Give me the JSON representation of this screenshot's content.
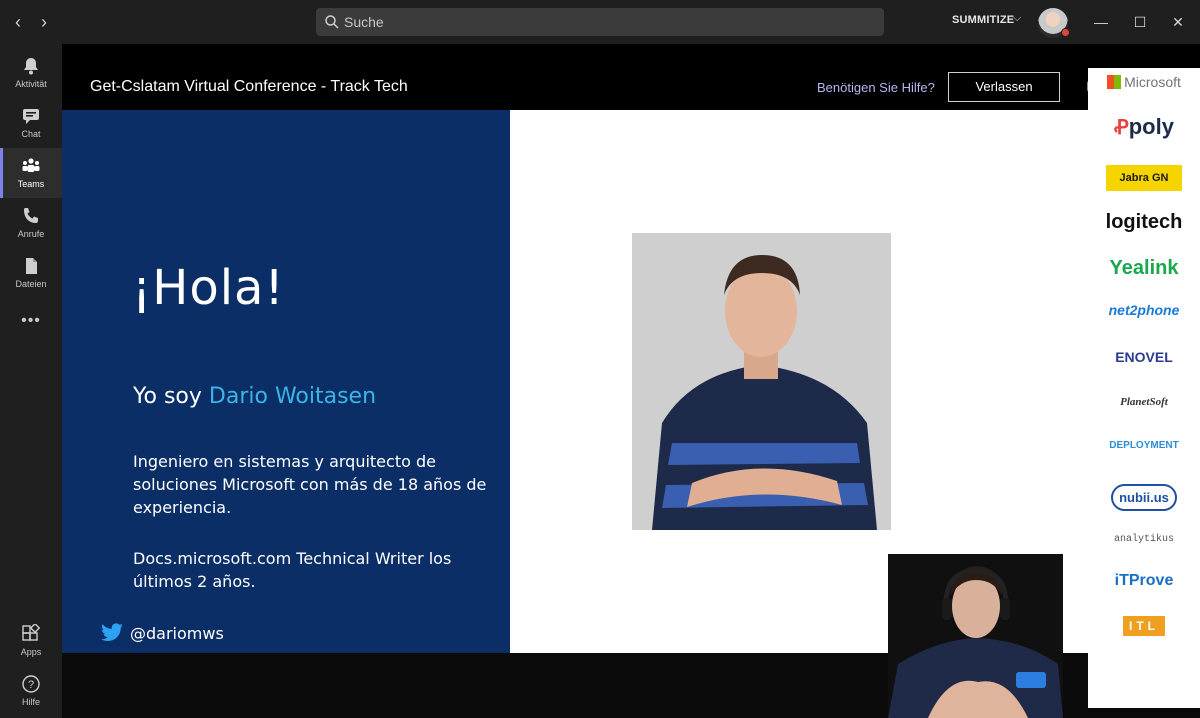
{
  "titlebar": {
    "back": "‹",
    "forward": "›",
    "search_placeholder": "Suche",
    "org_name": "SUMMITIZE",
    "minimize": "—",
    "maximize": "☐",
    "close": "✕"
  },
  "rail": {
    "items": [
      {
        "label": "Aktivität",
        "icon": "bell-icon"
      },
      {
        "label": "Chat",
        "icon": "chat-icon"
      },
      {
        "label": "Teams",
        "icon": "teams-icon",
        "active": true
      },
      {
        "label": "Anrufe",
        "icon": "phone-icon"
      },
      {
        "label": "Dateien",
        "icon": "file-icon"
      },
      {
        "label": "",
        "icon": "more-icon"
      },
      {
        "label": "Apps",
        "icon": "apps-icon"
      },
      {
        "label": "Hilfe",
        "icon": "help-icon"
      }
    ],
    "more": "•••"
  },
  "meeting": {
    "title": "Get-Cslatam Virtual Conference - Track Tech",
    "help_link": "Benötigen Sie Hilfe?",
    "leave_label": "Verlassen"
  },
  "slide": {
    "hola": "¡Hola!",
    "intro_prefix": "Yo soy ",
    "speaker_name": "Dario Woitasen",
    "bio": "Ingeniero en sistemas y arquitecto de soluciones Microsoft con más de 18 años de experiencia.",
    "bio2": "Docs.microsoft.com Technical Writer los últimos 2 años.",
    "twitter_handle": "@dariomws"
  },
  "sponsors": [
    {
      "name": "Microsoft",
      "color": "#737373"
    },
    {
      "name": "poly",
      "color": "#1c2b4a"
    },
    {
      "name": "Jabra GN",
      "color": "#1a1a1a",
      "bg": "#f5d400"
    },
    {
      "name": "logitech",
      "color": "#111111"
    },
    {
      "name": "Yealink",
      "color": "#1aa84c"
    },
    {
      "name": "net2phone",
      "color": "#1a7ad9"
    },
    {
      "name": "ENOVEL",
      "color": "#2d3b8f"
    },
    {
      "name": "PlanetSoft",
      "color": "#333333"
    },
    {
      "name": "DEPLOYMENT",
      "color": "#2a8fd6"
    },
    {
      "name": "nubii.us",
      "color": "#1f4fa3"
    },
    {
      "name": "analytikus",
      "color": "#555555"
    },
    {
      "name": "iTProve",
      "color": "#1b6fc2"
    },
    {
      "name": "ITL",
      "color": "#f0a020"
    }
  ],
  "colors": {
    "accent": "#7b83eb",
    "slide_blue": "#0b2e66",
    "name_cyan": "#3cb4e6",
    "presence_busy": "#e8423d"
  }
}
